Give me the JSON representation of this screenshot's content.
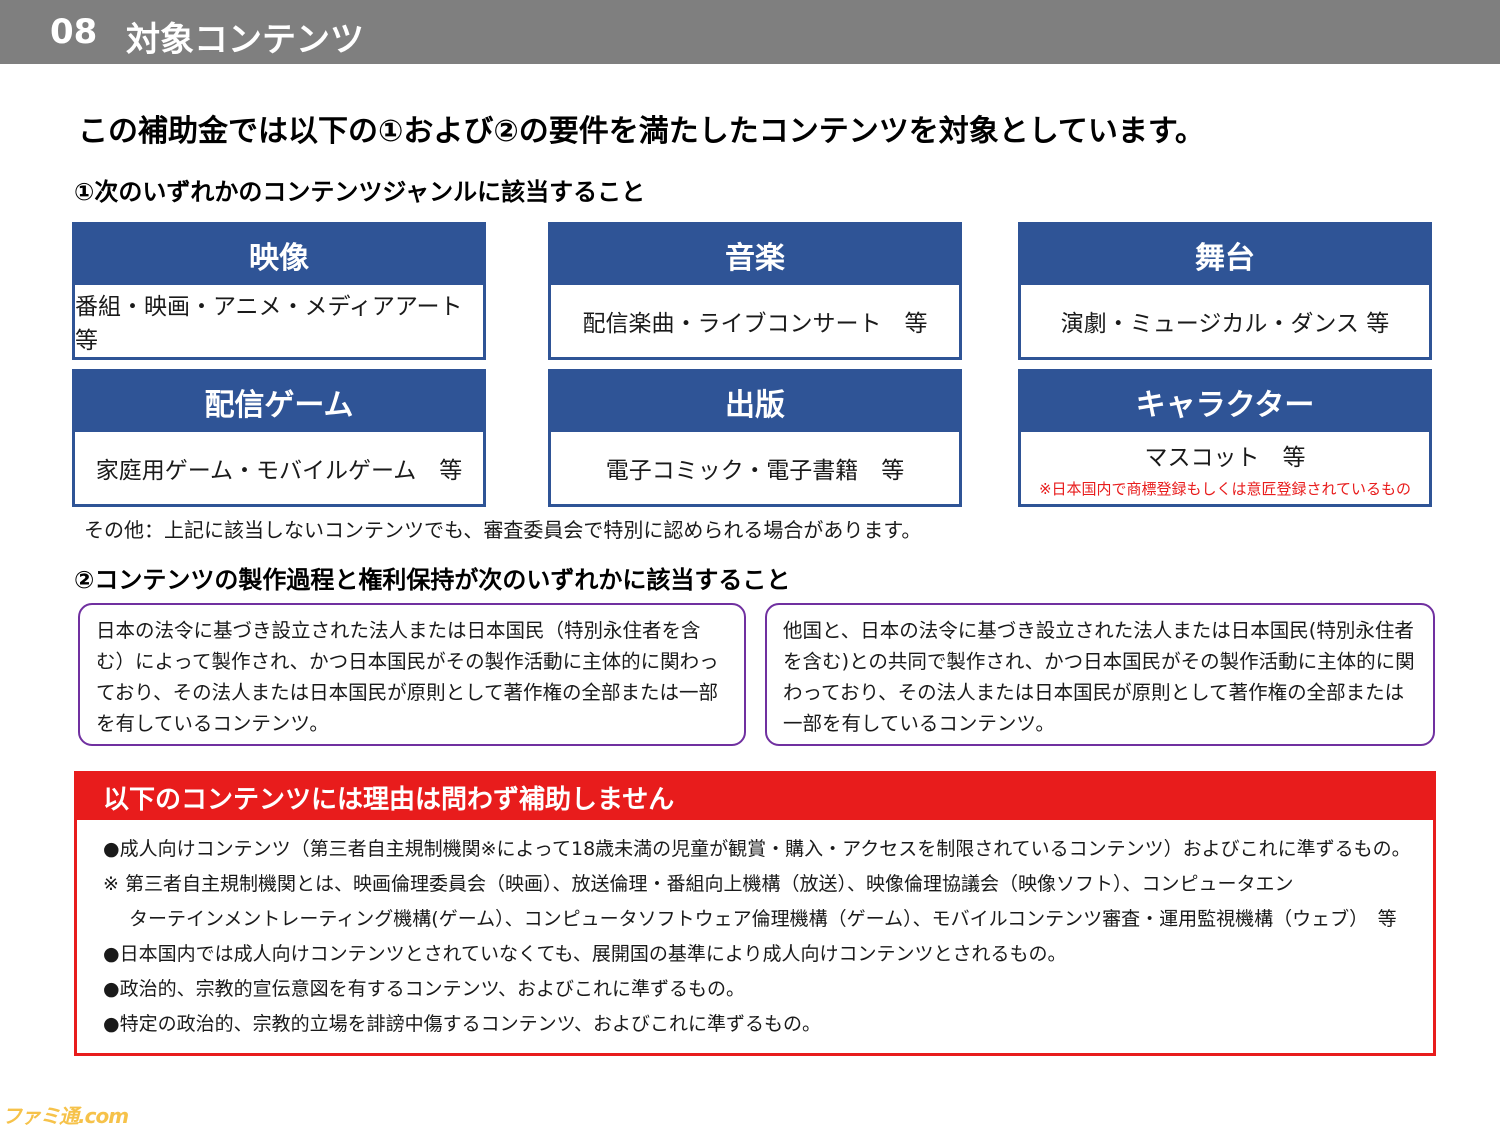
{
  "header": {
    "number": "08",
    "title": "対象コンテンツ"
  },
  "headline": "この補助金では以下の①および②の要件を満たしたコンテンツを対象としています。",
  "section1": {
    "title": "①次のいずれかのコンテンツジャンルに該当すること"
  },
  "genres": [
    {
      "title": "映像",
      "desc": "番組・映画・アニメ・メディアアート　等"
    },
    {
      "title": "音楽",
      "desc": "配信楽曲・ライブコンサート　等"
    },
    {
      "title": "舞台",
      "desc": "演劇・ミュージカル・ダンス 等"
    },
    {
      "title": "配信ゲーム",
      "desc": "家庭用ゲーム・モバイルゲーム　等"
    },
    {
      "title": "出版",
      "desc": "電子コミック・電子書籍　等"
    },
    {
      "title": "キャラクター",
      "desc": "マスコット　等",
      "note": "※日本国内で商標登録もしくは意匠登録されているもの"
    }
  ],
  "other_note": "その他：上記に該当しないコンテンツでも、審査委員会で特別に認められる場合があります。",
  "section2": {
    "title": "②コンテンツの製作過程と権利保持が次のいずれかに該当すること"
  },
  "requirements": [
    "日本の法令に基づき設立された法人または日本国民（特別永住者を含む）によって製作され、かつ日本国民がその製作活動に主体的に関わっており、その法人または日本国民が原則として著作権の全部または一部を有しているコンテンツ。",
    "他国と、日本の法令に基づき設立された法人または日本国民(特別永住者を含む)との共同で製作され、かつ日本国民がその製作活動に主体的に関わっており、その法人または日本国民が原則として著作権の全部または一部を有しているコンテンツ。"
  ],
  "exclusions": {
    "title": "以下のコンテンツには理由は問わず補助しません",
    "items": [
      "●成人向けコンテンツ（第三者自主規制機関※によって18歳未満の児童が観賞・購入・アクセスを制限されているコンテンツ）およびこれに準ずるもの。",
      "※ 第三者自主規制機関とは、映画倫理委員会（映画）、放送倫理・番組向上機構（放送）、映像倫理協議会（映像ソフト）、コンピュータエン",
      "ターテインメントレーティング機構(ゲーム）、コンピュータソフトウェア倫理機構（ゲーム）、モバイルコンテンツ審査・運用監視機構（ウェブ）　等",
      "●日本国内では成人向けコンテンツとされていなくても、展開国の基準により成人向けコンテンツとされるもの。",
      "●政治的、宗教的宣伝意図を有するコンテンツ、およびこれに準ずるもの。",
      "●特定の政治的、宗教的立場を誹謗中傷するコンテンツ、およびこれに準ずるもの。"
    ]
  },
  "watermark": "ファミ通.com",
  "colors": {
    "header_bg": "#7f7f7f",
    "genre_blue": "#2f5496",
    "requirement_border": "#7030a0",
    "exclusion_red": "#e81c1c"
  }
}
